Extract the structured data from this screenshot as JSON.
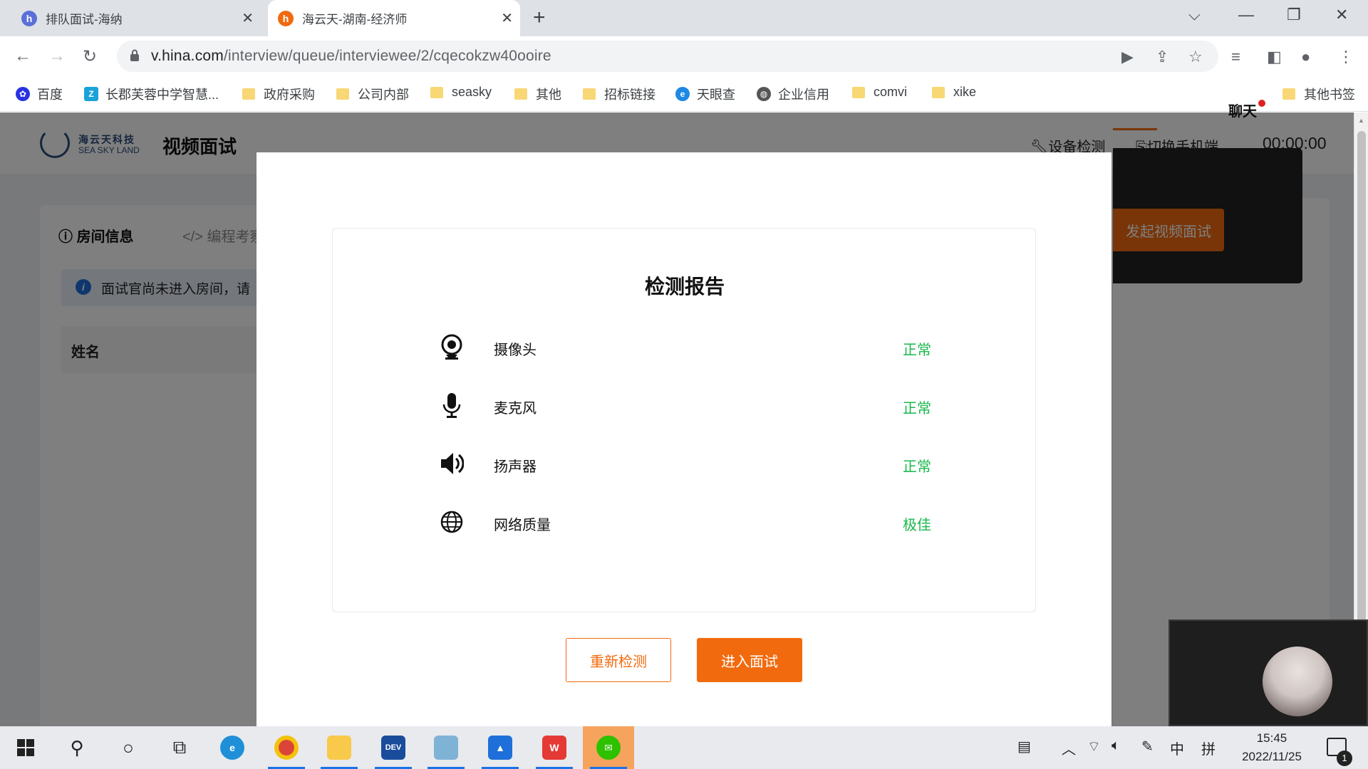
{
  "browser": {
    "tabs": [
      {
        "favicon": "h",
        "title": "排队面试-海纳"
      },
      {
        "favicon": "h",
        "title": "海云天-湖南-经济师"
      }
    ],
    "url_host": "v.hina.com",
    "url_path": "/interview/queue/interviewee/2/cqecokzw40ooire",
    "bookmarks": [
      "百度",
      "长郡芙蓉中学智慧...",
      "政府采购",
      "公司内部",
      "seasky",
      "其他",
      "招标链接",
      "天眼查",
      "企业信用",
      "comvi",
      "xike"
    ],
    "other_bookmarks": "其他书签"
  },
  "app": {
    "logo_cn": "海云天科技",
    "logo_en": "SEA SKY LAND",
    "title": "视频面试",
    "device_check": "设备检测",
    "switch_mobile": "切换手机端",
    "timer": "00:00:00"
  },
  "left_panel": {
    "tab_room": "房间信息",
    "tab_code": "编程考察",
    "notice": "面试官尚未进入房间，请",
    "name_header": "姓名"
  },
  "right_panel": {
    "chat_tab": "聊天",
    "start_video": "发起视频面试"
  },
  "modal": {
    "title": "检测报告",
    "rows": [
      {
        "icon": "webcam-icon",
        "label": "摄像头",
        "status": "正常"
      },
      {
        "icon": "microphone-icon",
        "label": "麦克风",
        "status": "正常"
      },
      {
        "icon": "speaker-icon",
        "label": "扬声器",
        "status": "正常"
      },
      {
        "icon": "globe-icon",
        "label": "网络质量",
        "status": "极佳"
      }
    ],
    "retry_button": "重新检测",
    "enter_button": "进入面试",
    "status_color": "#18b84b",
    "accent_color": "#f26a0e"
  },
  "taskbar": {
    "time": "15:45",
    "date": "2022/11/25",
    "ime_lang": "中",
    "ime_mode": "拼",
    "notifications": "1"
  }
}
